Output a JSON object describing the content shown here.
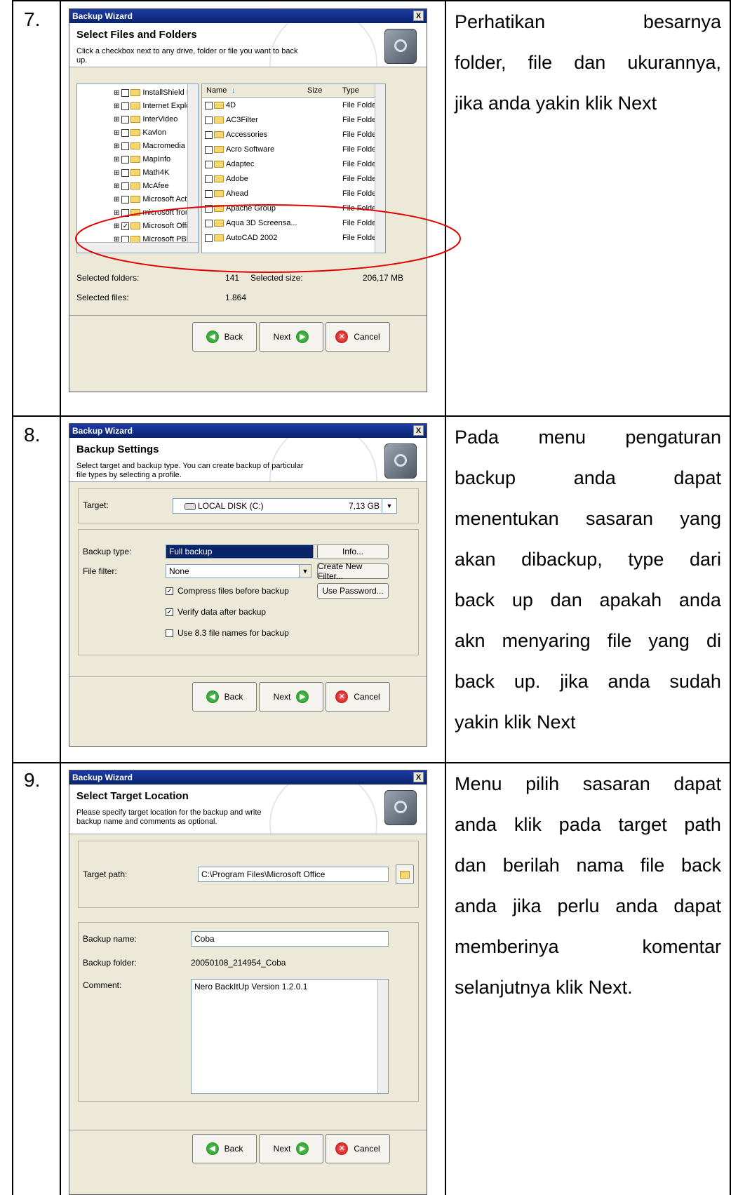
{
  "rows": [
    {
      "num": "7.",
      "desc_lines": [
        "Perhatikan besarnya",
        "folder, file dan ukurannya,",
        "jika anda yakin klik Next"
      ]
    },
    {
      "num": "8.",
      "desc_lines": [
        "Pada menu pengaturan",
        "backup anda dapat",
        "menentukan sasaran yang",
        "akan dibackup, type dari",
        "back up dan apakah anda",
        "akn menyaring file yang di",
        "back up. jika anda sudah",
        "yakin klik Next"
      ]
    },
    {
      "num": "9.",
      "desc_lines": [
        "Menu pilih sasaran dapat",
        "anda klik pada target path",
        "dan berilah nama file back",
        "anda jika perlu anda dapat",
        "memberinya komentar",
        "selanjutnya klik Next."
      ]
    }
  ],
  "wizard_title": "Backup Wizard",
  "close": "X",
  "buttons": {
    "back": "Back",
    "next": "Next",
    "cancel": "Cancel"
  },
  "w1": {
    "heading": "Select Files and Folders",
    "sub": "Click a checkbox next to any drive, folder or file you want to back up.",
    "tree": [
      "InstallShield Insta",
      "Internet Explorer",
      "InterVideo",
      "Kavlon",
      "Macromedia",
      "MapInfo",
      "Math4K",
      "McAfee",
      "Microsoft ActiveSy",
      "microsoft frontpa",
      "Microsoft Office",
      "Microsoft PBL"
    ],
    "tree_checked_index": 10,
    "cols": {
      "name": "Name",
      "size": "Size",
      "type": "Type"
    },
    "files": [
      "4D",
      "AC3Filter",
      "Accessories",
      "Acro Software",
      "Adaptec",
      "Adobe",
      "Ahead",
      "Apache Group",
      "Aqua 3D Screensa...",
      "AutoCAD 2002"
    ],
    "file_type": "File Folder",
    "sel_folders_label": "Selected folders:",
    "sel_folders": "141",
    "sel_size_label": "Selected size:",
    "sel_size": "206,17 MB",
    "sel_files_label": "Selected files:",
    "sel_files": "1.864"
  },
  "w2": {
    "heading": "Backup Settings",
    "sub": "Select target and backup type. You can create backup of particular file types by selecting a profile.",
    "target_label": "Target:",
    "target_value": "LOCAL DISK (C:)",
    "target_size": "7,13 GB",
    "type_label": "Backup type:",
    "type_value": "Full backup",
    "info": "Info...",
    "filter_label": "File filter:",
    "filter_value": "None",
    "create_filter": "Create New Filter...",
    "use_password": "Use Password...",
    "checks": [
      {
        "label": "Compress files before backup",
        "checked": true
      },
      {
        "label": "Verify data after backup",
        "checked": true
      },
      {
        "label": "Use 8.3 file names for backup",
        "checked": false
      }
    ]
  },
  "w3": {
    "heading": "Select Target Location",
    "sub": "Please specify target location for the backup and write backup name and comments as optional.",
    "path_label": "Target path:",
    "path_value": "C:\\Program Files\\Microsoft Office",
    "name_label": "Backup name:",
    "name_value": "Coba",
    "folder_label": "Backup folder:",
    "folder_value": "20050108_214954_Coba",
    "comment_label": "Comment:",
    "comment_value": "Nero BackItUp Version 1.2.0.1"
  },
  "colors": {
    "title_bar": "#0a246a",
    "dialog": "#ece9d8",
    "highlight_ellipse": "#e00000",
    "selection": "#0a246a"
  }
}
